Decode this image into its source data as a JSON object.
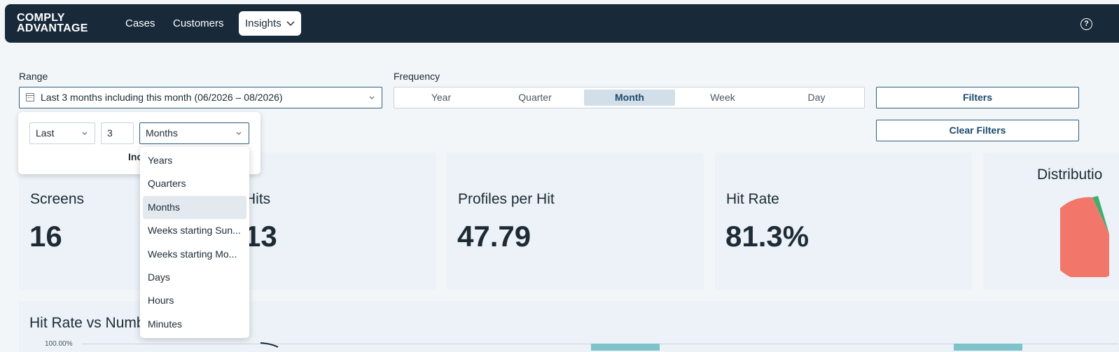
{
  "app": {
    "logo_line1": "COMPLY",
    "logo_line2": "ADVANTAGE"
  },
  "nav": {
    "items": [
      {
        "label": "Cases"
      },
      {
        "label": "Customers"
      }
    ],
    "active_dropdown": "Insights",
    "help_icon": "question-circle-icon"
  },
  "range": {
    "label": "Range",
    "value": "Last 3 months including this month (06/2026 – 08/2026)",
    "icon": "calendar-icon"
  },
  "frequency": {
    "label": "Frequency",
    "options": [
      "Year",
      "Quarter",
      "Month",
      "Week",
      "Day"
    ],
    "selected": "Month"
  },
  "filters": {
    "filters_label": "Filters",
    "clear_label": "Clear Filters"
  },
  "popover": {
    "mode_value": "Last",
    "count_value": "3",
    "unit_value": "Months",
    "partial_text": "Inc"
  },
  "unit_menu": {
    "options": [
      "Years",
      "Quarters",
      "Months",
      "Weeks starting Sun...",
      "Weeks starting Mo...",
      "Days",
      "Hours",
      "Minutes"
    ],
    "selected": "Months"
  },
  "stats": {
    "screens": {
      "title": "Screens",
      "value": "16"
    },
    "hits": {
      "title": "Hits",
      "value": "13"
    },
    "profiles_per_hit": {
      "title": "Profiles per Hit",
      "value": "47.79"
    },
    "hit_rate": {
      "title": "Hit Rate",
      "value": "81.3%"
    }
  },
  "distribution": {
    "title": "Distributio"
  },
  "chart": {
    "title": "Hit Rate vs Numb",
    "tick_top": "100.00%"
  },
  "colors": {
    "nav_bg": "#18293a",
    "accent": "#2c5e7e",
    "active_segment": "#d2dee8",
    "card_bg": "#ecf2f7",
    "pie_red": "#f2776a",
    "pie_green": "#3fae6f",
    "bar_teal": "#7ec3c9"
  }
}
